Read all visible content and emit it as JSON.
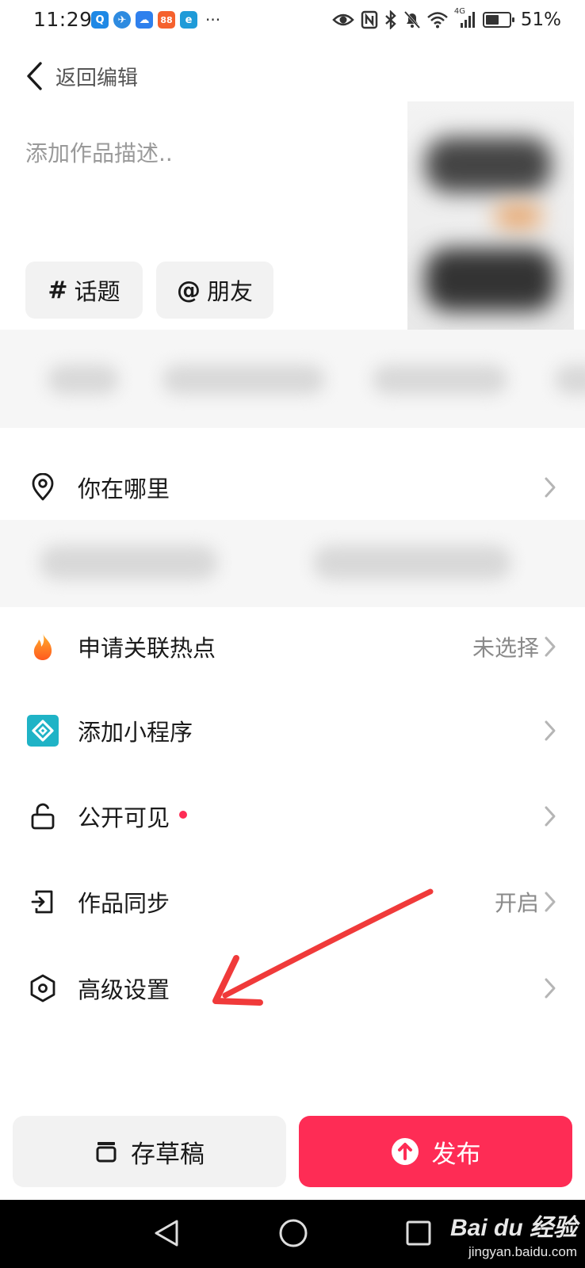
{
  "status_bar": {
    "time": "11:29",
    "app_icons": [
      {
        "icon": "qq-browser-icon",
        "glyph": "Q",
        "color": "#1e88e5"
      },
      {
        "icon": "telegram-like-icon",
        "glyph": "✈",
        "color": "#2e8be0"
      },
      {
        "icon": "weather-icon",
        "glyph": "☁",
        "color": "#2f80ed"
      },
      {
        "icon": "taobao-style-icon",
        "glyph": "88",
        "color": "#f5612d"
      },
      {
        "icon": "browser-e-icon",
        "glyph": "e",
        "color": "#1f9bd8"
      }
    ],
    "more": "···",
    "network": "4G",
    "battery": "51%",
    "battery_level": 0.51
  },
  "header": {
    "back_label": "返回编辑"
  },
  "editor": {
    "description_placeholder": "添加作品描述..",
    "chips": [
      {
        "symbol": "#",
        "label": "话题"
      },
      {
        "symbol": "@",
        "label": "朋友"
      }
    ]
  },
  "list": {
    "location": {
      "label": "你在哪里"
    },
    "hot_topic": {
      "label": "申请关联热点",
      "value": "未选择"
    },
    "mini_program": {
      "label": "添加小程序"
    },
    "visibility": {
      "label": "公开可见"
    },
    "sync": {
      "label": "作品同步",
      "value": "开启"
    },
    "advanced": {
      "label": "高级设置"
    }
  },
  "footer": {
    "draft_label": "存草稿",
    "publish_label": "发布"
  },
  "watermark": {
    "logo": "Bai du 经验",
    "url": "jingyan.baidu.com"
  },
  "colors": {
    "accent": "#fe2c55",
    "annotation": "#f03a3a",
    "mini_program": "#1fb3c6"
  }
}
